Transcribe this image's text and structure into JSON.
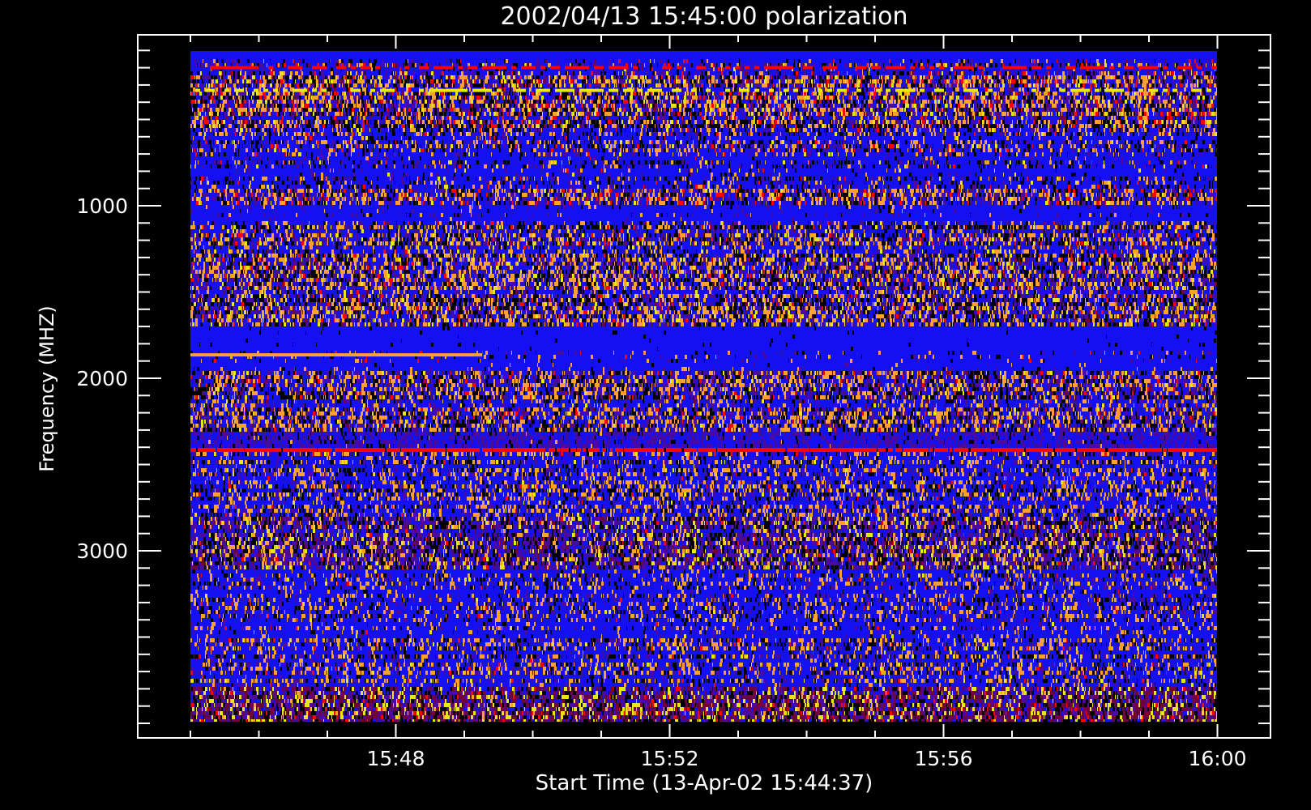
{
  "chart_data": {
    "type": "heatmap",
    "title": "2002/04/13 15:45:00 polarization",
    "xlabel": "Start Time (13-Apr-02 15:44:37)",
    "ylabel": "Frequency (MHZ)",
    "x_start": "15:45:00",
    "x_end": "16:00:00",
    "xlim_minutes_from_start": [
      -0.77,
      15.78
    ],
    "x_ticks": [
      {
        "label": "15:48",
        "minutes": 3
      },
      {
        "label": "15:52",
        "minutes": 7
      },
      {
        "label": "15:56",
        "minutes": 11
      },
      {
        "label": "16:00",
        "minutes": 15
      }
    ],
    "x_minor_step_minutes": 1,
    "freq_range_mhz": [
      100,
      4000
    ],
    "ylim": [
      6,
      4080
    ],
    "y_inverted": true,
    "y_ticks": [
      {
        "label": "1000",
        "value": 1000
      },
      {
        "label": "2000",
        "value": 2000
      },
      {
        "label": "3000",
        "value": 3000
      }
    ],
    "y_minor_step": 100,
    "grid": false,
    "palette": [
      "#1410f0",
      "#4a0aa0",
      "#ffa030",
      "#e6e619",
      "#ff0000",
      "#70003f",
      "#000000",
      "#0000b0"
    ],
    "bands": [
      {
        "f": [
          100,
          150
        ],
        "w": [
          1,
          0,
          0,
          0,
          0,
          0,
          0,
          0
        ]
      },
      {
        "f": [
          150,
          250
        ],
        "w": [
          6,
          2,
          1,
          0.3,
          0.6,
          0.3,
          2,
          0
        ]
      },
      {
        "f": [
          250,
          550
        ],
        "w": [
          3,
          2,
          3,
          1,
          1,
          0.5,
          3,
          0
        ]
      },
      {
        "f": [
          550,
          700
        ],
        "w": [
          6,
          1,
          2,
          0.3,
          0.3,
          0,
          2,
          0
        ]
      },
      {
        "f": [
          700,
          900
        ],
        "w": [
          9,
          1,
          1,
          0.2,
          0.2,
          0,
          1,
          0
        ]
      },
      {
        "f": [
          900,
          1000
        ],
        "w": [
          4,
          2,
          3,
          0.5,
          0.8,
          0,
          2,
          0
        ]
      },
      {
        "f": [
          1000,
          1080
        ],
        "w": [
          12,
          1,
          0.5,
          0,
          0,
          0,
          0.5,
          0
        ]
      },
      {
        "f": [
          1080,
          1700
        ],
        "w": [
          4,
          2,
          3,
          0.8,
          0.4,
          0.3,
          2.5,
          0
        ]
      },
      {
        "f": [
          1700,
          1850
        ],
        "w": [
          20,
          0,
          0,
          0,
          0,
          0,
          0.3,
          0
        ]
      },
      {
        "f": [
          1850,
          1950
        ],
        "w": [
          14,
          0.5,
          0.8,
          0,
          0.1,
          0,
          0.4,
          0
        ]
      },
      {
        "f": [
          1950,
          2300
        ],
        "w": [
          4,
          2,
          3,
          0.4,
          0.4,
          0.3,
          2.5,
          0
        ]
      },
      {
        "f": [
          2300,
          2400
        ],
        "w": [
          8,
          6,
          0.2,
          0,
          0,
          0,
          1,
          0
        ]
      },
      {
        "f": [
          2400,
          2430
        ],
        "w": [
          0.5,
          0,
          0,
          0,
          12,
          0,
          0.5,
          0
        ]
      },
      {
        "f": [
          2430,
          2800
        ],
        "w": [
          7,
          1.5,
          3,
          0.3,
          0.2,
          0,
          2,
          0
        ]
      },
      {
        "f": [
          2800,
          3100
        ],
        "w": [
          3,
          4,
          2,
          1,
          0.2,
          0.8,
          3,
          0
        ]
      },
      {
        "f": [
          3100,
          3500
        ],
        "w": [
          9,
          1,
          2,
          0.2,
          0.1,
          0,
          1.5,
          0
        ]
      },
      {
        "f": [
          3500,
          3800
        ],
        "w": [
          7,
          1.5,
          3,
          0.3,
          0.2,
          0,
          2,
          0
        ]
      },
      {
        "f": [
          3800,
          4000
        ],
        "w": [
          1,
          3,
          0.5,
          2,
          0.5,
          4,
          3,
          0
        ]
      }
    ],
    "lines": [
      {
        "f": 1855,
        "color": "#ffa030",
        "minutes": [
          0,
          4.2
        ]
      },
      {
        "f": 322,
        "color": "#e6e619",
        "minutes": [
          0,
          15
        ],
        "duty": 0.5
      },
      {
        "f": 190,
        "color": "#ff0000",
        "minutes": [
          0,
          15
        ],
        "duty": 0.6
      }
    ]
  }
}
